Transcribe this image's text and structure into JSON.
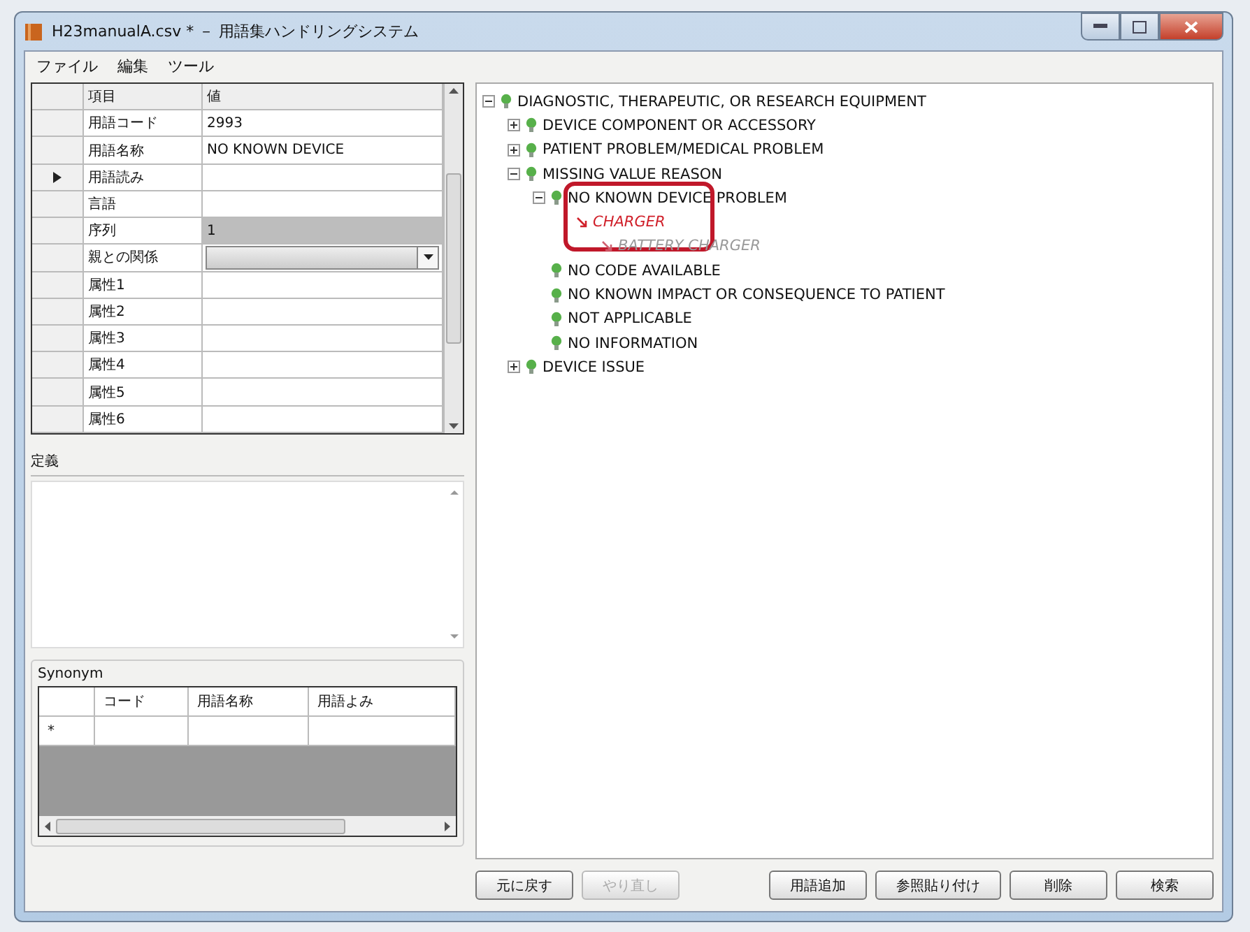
{
  "window": {
    "title": "H23manualA.csv *  －  用語集ハンドリングシステム"
  },
  "menu": [
    "ファイル",
    "編集",
    "ツール"
  ],
  "property_grid": {
    "columns": [
      "項目",
      "値"
    ],
    "rows": [
      {
        "label": "用語コード",
        "value": "2993",
        "kind": "text",
        "selected": false,
        "disabled": false
      },
      {
        "label": "用語名称",
        "value": "NO KNOWN DEVICE",
        "kind": "text",
        "selected": false,
        "disabled": false
      },
      {
        "label": "用語読み",
        "kind": "text",
        "selected": true,
        "disabled": false
      },
      {
        "label": "言語",
        "kind": "text",
        "selected": false,
        "disabled": false
      },
      {
        "label": "序列",
        "value": "1",
        "kind": "text",
        "selected": false,
        "disabled": true
      },
      {
        "label": "親との関係",
        "kind": "dropdown",
        "selected": false,
        "disabled": false
      },
      {
        "label": "属性1",
        "kind": "text",
        "selected": false,
        "disabled": false
      },
      {
        "label": "属性2",
        "kind": "text",
        "selected": false,
        "disabled": false
      },
      {
        "label": "属性3",
        "kind": "text",
        "selected": false,
        "disabled": false
      },
      {
        "label": "属性4",
        "kind": "text",
        "selected": false,
        "disabled": false
      },
      {
        "label": "属性5",
        "kind": "text",
        "selected": false,
        "disabled": false
      },
      {
        "label": "属性6",
        "kind": "text",
        "selected": false,
        "disabled": false
      }
    ]
  },
  "definition": {
    "label": "定義"
  },
  "synonym": {
    "title": "Synonym",
    "columns": [
      "コード",
      "用語名称",
      "用語よみ"
    ],
    "new_row_marker": "*"
  },
  "tree": [
    {
      "label": "DIAGNOSTIC, THERAPEUTIC, OR RESEARCH EQUIPMENT",
      "kind": "node",
      "expanded": true,
      "children": [
        {
          "label": "DEVICE COMPONENT OR ACCESSORY",
          "kind": "node",
          "expanded": false
        },
        {
          "label": "PATIENT PROBLEM/MEDICAL PROBLEM",
          "kind": "node",
          "expanded": false
        },
        {
          "label": "MISSING VALUE REASON",
          "kind": "node",
          "expanded": true,
          "children": [
            {
              "label": "NO KNOWN DEVICE PROBLEM",
              "kind": "node",
              "expanded": true,
              "highlighted": true,
              "children": [
                {
                  "label": "CHARGER",
                  "kind": "reference",
                  "children": [
                    {
                      "label": "BATTERY CHARGER",
                      "kind": "reference-child"
                    }
                  ]
                }
              ]
            },
            {
              "label": "NO CODE AVAILABLE",
              "kind": "node"
            },
            {
              "label": "NO KNOWN IMPACT OR CONSEQUENCE TO PATIENT",
              "kind": "node"
            },
            {
              "label": "NOT APPLICABLE",
              "kind": "node"
            },
            {
              "label": "NO INFORMATION",
              "kind": "node"
            }
          ]
        },
        {
          "label": "DEVICE ISSUE",
          "kind": "node",
          "expanded": false
        }
      ]
    }
  ],
  "buttons": [
    {
      "label": "元に戻す",
      "disabled": false
    },
    {
      "label": "やり直し",
      "disabled": true
    },
    {
      "label": "用語追加",
      "disabled": false
    },
    {
      "label": "参照貼り付け",
      "disabled": false
    },
    {
      "label": "削除",
      "disabled": false
    },
    {
      "label": "検索",
      "disabled": false
    }
  ]
}
